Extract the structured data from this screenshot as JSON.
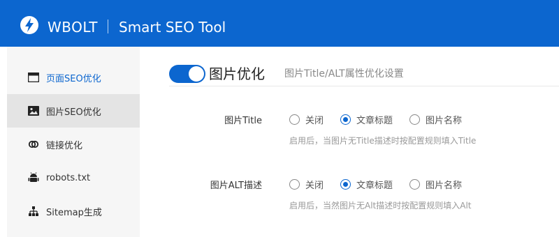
{
  "header": {
    "brand": "WBOLT",
    "app_title": "Smart SEO Tool"
  },
  "sidebar": {
    "items": [
      {
        "label": "页面SEO优化",
        "icon": "window-icon"
      },
      {
        "label": "图片SEO优化",
        "icon": "image-icon"
      },
      {
        "label": "链接优化",
        "icon": "link-icon"
      },
      {
        "label": "robots.txt",
        "icon": "android-icon"
      },
      {
        "label": "Sitemap生成",
        "icon": "sitemap-icon"
      }
    ]
  },
  "main": {
    "toggle_on": true,
    "title": "图片优化",
    "subtitle": "图片Title/ALT属性优化设置",
    "rows": [
      {
        "label": "图片Title",
        "options": [
          "关闭",
          "文章标题",
          "图片名称"
        ],
        "selected": "文章标题",
        "hint": "启用后，当图片无Title描述时按配置规则填入Title"
      },
      {
        "label": "图片ALT描述",
        "options": [
          "关闭",
          "文章标题",
          "图片名称"
        ],
        "selected": "文章标题",
        "hint": "启用后，当然图片无Alt描述时按配置规则填入Alt"
      }
    ]
  },
  "colors": {
    "accent": "#0c66cf",
    "sidebar_bg": "#f6f6f6",
    "sidebar_selected": "#e4e4e4"
  }
}
